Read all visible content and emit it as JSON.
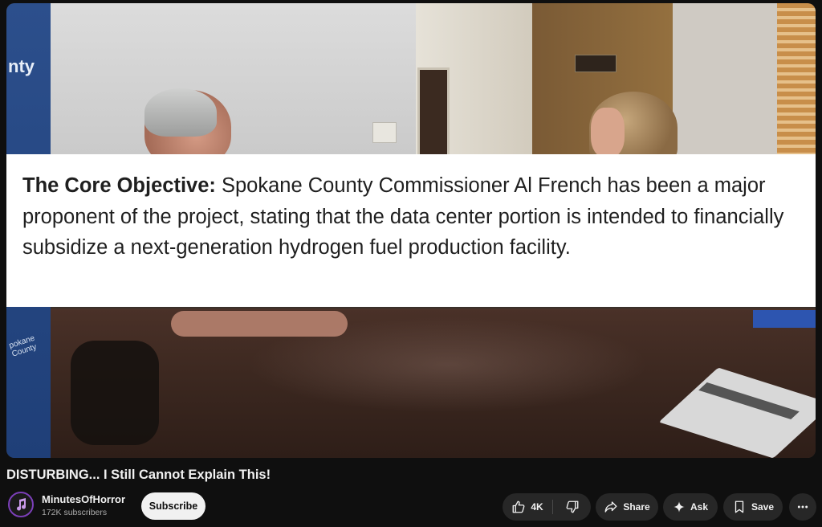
{
  "video": {
    "caption_bold": "The Core Objective:",
    "caption_text": " Spokane County Commissioner Al French has been a major proponent of the project, stating that the data center portion is intended to financially subsidize a next-generation hydrogen fuel production facility.",
    "scene_banner_text": "nty",
    "scene_banner_text_2": "pokane County"
  },
  "title": "DISTURBING... I Still Cannot Explain This!",
  "channel": {
    "name": "MinutesOfHorror",
    "subscribers": "172K subscribers",
    "subscribe_label": "Subscribe"
  },
  "actions": {
    "like_count": "4K",
    "share_label": "Share",
    "ask_label": "Ask",
    "save_label": "Save"
  },
  "icons": {
    "like": "thumbs-up-icon",
    "dislike": "thumbs-down-icon",
    "share": "share-arrow-icon",
    "ask": "sparkle-icon",
    "save": "bookmark-icon",
    "more": "more-horizontal-icon"
  },
  "colors": {
    "background": "#0f0f0f",
    "pill": "#272727",
    "subscribe_bg": "#f1f1f1",
    "avatar_ring": "#7b3fb8"
  }
}
